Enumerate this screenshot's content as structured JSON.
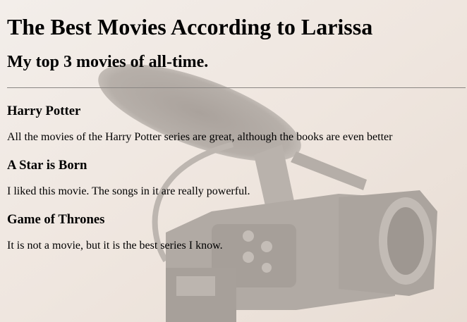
{
  "page": {
    "title": "The Best Movies According to Larissa",
    "subtitle": "My top 3 movies of all-time."
  },
  "movies": [
    {
      "name": "Harry Potter",
      "description": "All the movies of the Harry Potter series are great, although the books are even better"
    },
    {
      "name": "A Star is Born",
      "description": "I liked this movie. The songs in it are really powerful."
    },
    {
      "name": "Game of Thrones",
      "description": "It is not a movie, but it is the best series I know."
    }
  ]
}
